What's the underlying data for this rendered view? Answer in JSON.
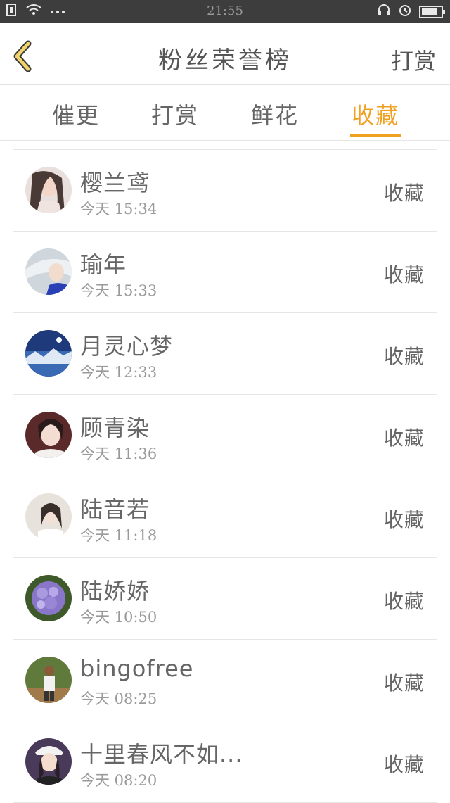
{
  "status_bar": {
    "time": "21:55"
  },
  "navbar": {
    "title": "粉丝荣誉榜",
    "action": "打赏"
  },
  "tabs": [
    {
      "label": "催更"
    },
    {
      "label": "打赏"
    },
    {
      "label": "鲜花"
    },
    {
      "label": "收藏"
    }
  ],
  "active_tab": "收藏",
  "colors": {
    "accent": "#f0a022",
    "statusbar": "#3d3d3d"
  },
  "list": [
    {
      "name": "樱兰鸢",
      "time": "今天 15:34",
      "action": "收藏"
    },
    {
      "name": "瑜年",
      "time": "今天 15:33",
      "action": "收藏"
    },
    {
      "name": "月灵心梦",
      "time": "今天 12:33",
      "action": "收藏"
    },
    {
      "name": "顾青染",
      "time": "今天 11:36",
      "action": "收藏"
    },
    {
      "name": "陆音若",
      "time": "今天 11:18",
      "action": "收藏"
    },
    {
      "name": "陆娇娇",
      "time": "今天 10:50",
      "action": "收藏"
    },
    {
      "name": "bingofree",
      "time": "今天 08:25",
      "action": "收藏"
    },
    {
      "name": "十里春风不如...",
      "time": "今天 08:20",
      "action": "收藏"
    }
  ]
}
